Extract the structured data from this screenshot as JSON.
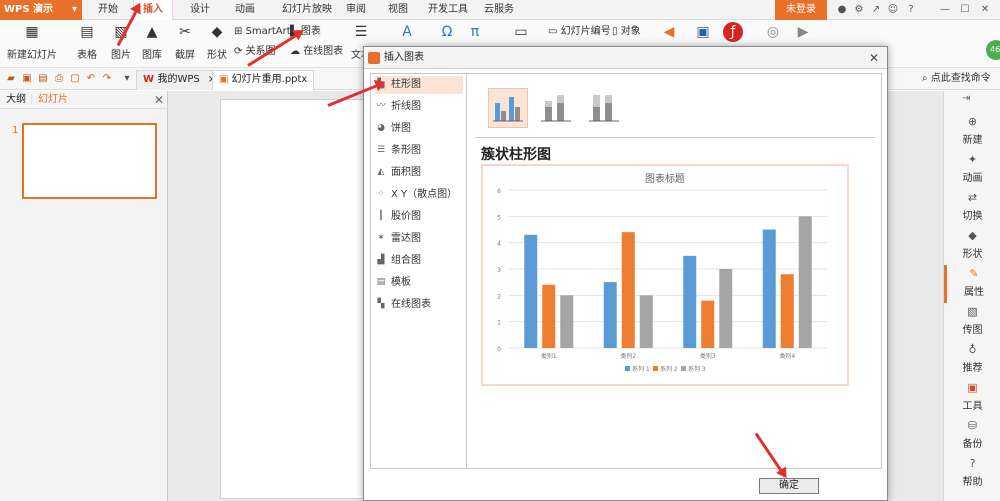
{
  "menu": {
    "app_title": "WPS 演示",
    "tabs": [
      "开始",
      "插入",
      "设计",
      "动画",
      "幻灯片放映",
      "审阅",
      "视图",
      "开发工具",
      "云服务"
    ],
    "active_tab": "插入",
    "login_label": "未登录"
  },
  "ribbon": {
    "new_slide": "新建幻灯片",
    "table": "表格",
    "picture": "图片",
    "gallery": "图库",
    "screenshot": "截屏",
    "shape": "形状",
    "smartart": "SmartArt",
    "chart": "图表",
    "relation": "关系图",
    "online_chart": "在线图表",
    "text": "文本",
    "slide_number": "幻灯片编号",
    "object": "对象"
  },
  "quickbar": {
    "tabs": [
      "我的WPS",
      "幻灯片重用.pptx"
    ],
    "active_tab": "幻灯片重用.pptx",
    "search": "点此查找命令"
  },
  "leftpane": {
    "tabs": [
      "大纲",
      "幻灯片"
    ],
    "active_tab": "幻灯片",
    "slide_number": "1"
  },
  "rightbar": {
    "items": [
      "新建",
      "动画",
      "切换",
      "形状",
      "属性",
      "传图",
      "推荐",
      "工具",
      "备份",
      "帮助"
    ],
    "badge": "46"
  },
  "dialog": {
    "title": "插入图表",
    "chart_types": [
      "柱形图",
      "折线图",
      "饼图",
      "条形图",
      "面积图",
      "X Y（散点图）",
      "股价图",
      "雷达图",
      "组合图",
      "模板",
      "在线图表"
    ],
    "selected_type": "柱形图",
    "subtype_title": "簇状柱形图",
    "ok_label": "确定"
  },
  "colors": {
    "accent": "#e8702a",
    "series1": "#5b9bd5",
    "series2": "#ed7d31",
    "series3": "#a5a5a5",
    "arrow": "#e13030"
  },
  "chart_data": {
    "type": "bar",
    "title": "图表标题",
    "categories": [
      "类别1",
      "类别2",
      "类别3",
      "类别4"
    ],
    "series": [
      {
        "name": "系列 1",
        "values": [
          4.3,
          2.5,
          3.5,
          4.5
        ]
      },
      {
        "name": "系列 2",
        "values": [
          2.4,
          4.4,
          1.8,
          2.8
        ]
      },
      {
        "name": "系列 3",
        "values": [
          2,
          2,
          3,
          5
        ]
      }
    ],
    "ylim": [
      0,
      6
    ],
    "yticks": [
      "0",
      "1",
      "2",
      "3",
      "4",
      "5",
      "6"
    ],
    "grid": true,
    "legend": "bottom"
  }
}
